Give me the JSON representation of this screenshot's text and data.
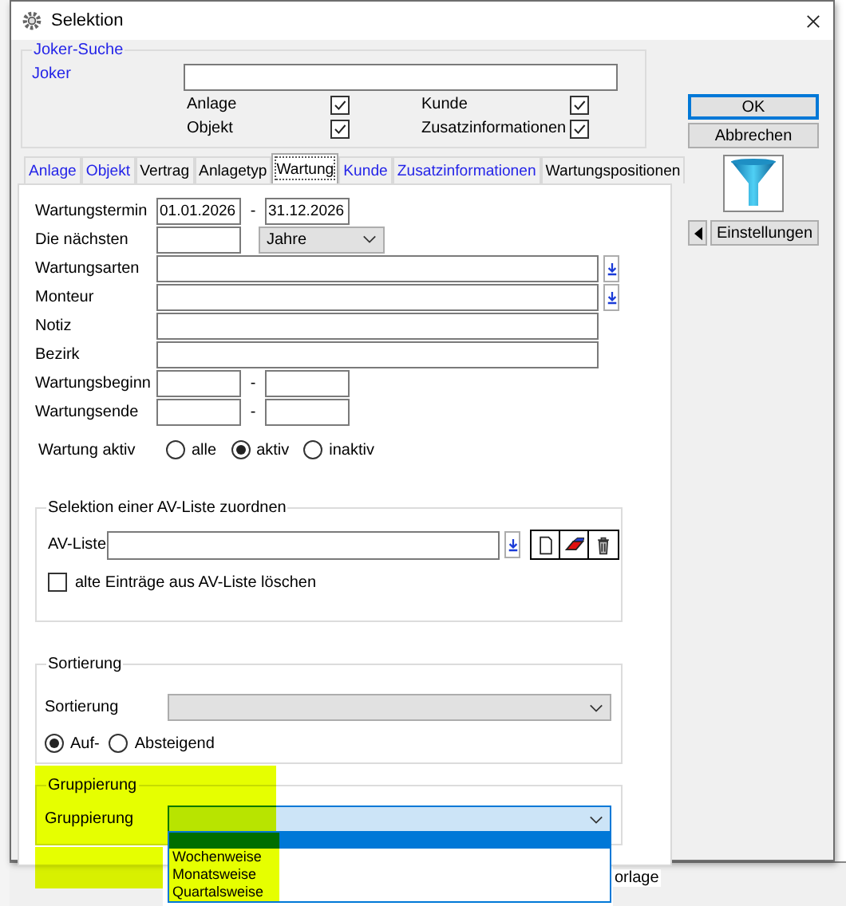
{
  "window": {
    "title": "Selektion"
  },
  "joker": {
    "legend": "Joker-Suche",
    "label": "Joker",
    "options": [
      {
        "label": "Anlage",
        "checked": true
      },
      {
        "label": "Kunde",
        "checked": true
      },
      {
        "label": "Objekt",
        "checked": true
      },
      {
        "label": "Zusatzinformationen",
        "checked": true
      }
    ]
  },
  "tabs": [
    {
      "label": "Anlage",
      "selected": false,
      "filtered": true
    },
    {
      "label": "Objekt",
      "selected": false,
      "filtered": true
    },
    {
      "label": "Vertrag",
      "selected": false,
      "filtered": false
    },
    {
      "label": "Anlagetyp",
      "selected": false,
      "filtered": false
    },
    {
      "label": "Wartung",
      "selected": true,
      "filtered": false
    },
    {
      "label": "Kunde",
      "selected": false,
      "filtered": true
    },
    {
      "label": "Zusatzinformationen",
      "selected": false,
      "filtered": true
    },
    {
      "label": "Wartungspositionen",
      "selected": false,
      "filtered": false
    }
  ],
  "form": [
    {
      "kind": "range",
      "label": "Wartungstermin",
      "from": "01.01.2026",
      "separator": "-",
      "to": "31.12.2026"
    },
    {
      "kind": "count",
      "label": "Die nächsten",
      "unit": "Jahre"
    },
    {
      "kind": "lookup",
      "label": "Wartungsarten"
    },
    {
      "kind": "lookup",
      "label": "Monteur"
    },
    {
      "kind": "text",
      "label": "Notiz"
    },
    {
      "kind": "text",
      "label": "Bezirk"
    },
    {
      "kind": "range",
      "label": "Wartungsbeginn",
      "separator": "-"
    },
    {
      "kind": "range",
      "label": "Wartungsende",
      "separator": "-"
    }
  ],
  "active_filter": {
    "label": "Wartung aktiv",
    "options": [
      {
        "label": "alle",
        "selected": false
      },
      {
        "label": "aktiv",
        "selected": true
      },
      {
        "label": "inaktiv",
        "selected": false
      }
    ]
  },
  "av_group": {
    "legend": "Selektion einer AV-Liste zuordnen",
    "label": "AV-Liste",
    "clear_old": {
      "label": "alte Einträge aus AV-Liste löschen",
      "checked": false
    }
  },
  "sort_group": {
    "legend": "Sortierung",
    "label": "Sortierung",
    "options": [
      {
        "label": "Auf-",
        "selected": true
      },
      {
        "label": "Absteigend",
        "selected": false
      }
    ]
  },
  "group_group": {
    "legend": "Gruppierung",
    "label": "Gruppierung",
    "expanded": true,
    "items": [
      {
        "selected": true
      },
      {
        "label": "Wochenweise",
        "selected": false
      },
      {
        "label": "Monatsweise",
        "selected": false
      },
      {
        "label": "Quartalsweise",
        "selected": false
      }
    ]
  },
  "buttons": [
    {
      "label": "OK",
      "kind": "default"
    },
    {
      "label": "Abbrechen",
      "kind": "normal"
    }
  ],
  "settings_button": {
    "label": "Einstellungen"
  },
  "background_window": {
    "cell_text": "orlage"
  }
}
